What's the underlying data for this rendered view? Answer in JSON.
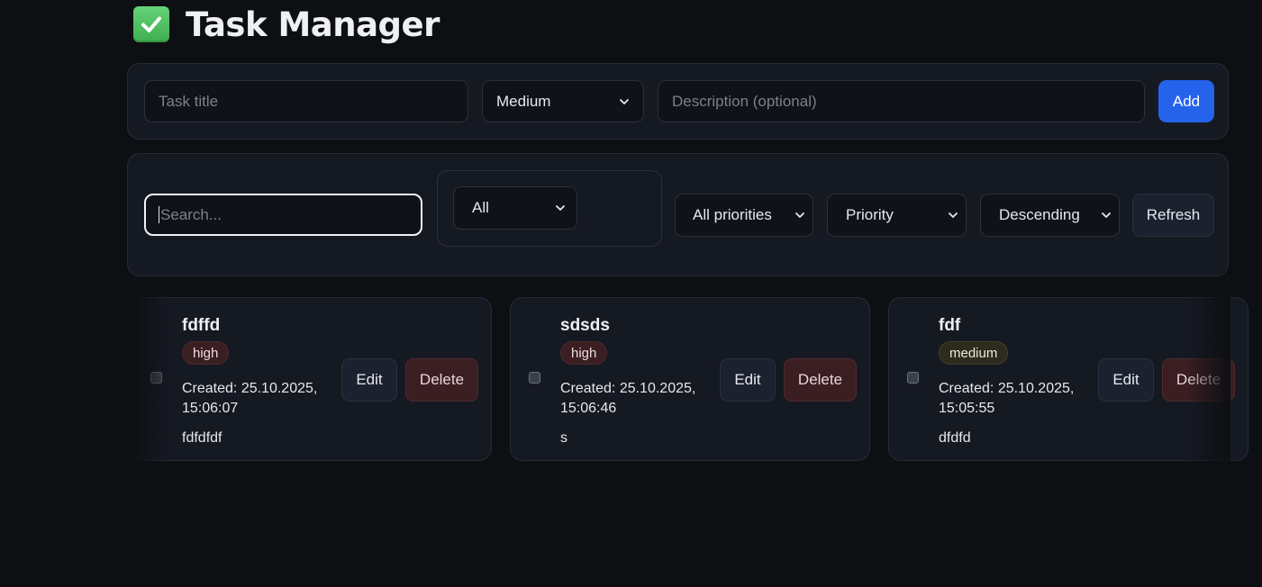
{
  "header": {
    "icon": "check-mark-button-icon",
    "title": "Task Manager"
  },
  "add_form": {
    "title_placeholder": "Task title",
    "priority_value": "Medium",
    "description_placeholder": "Description (optional)",
    "add_label": "Add"
  },
  "filters": {
    "search_placeholder": "Search...",
    "status_value": "All",
    "priority_filter_value": "All priorities",
    "sort_by_value": "Priority",
    "sort_order_value": "Descending",
    "refresh_label": "Refresh"
  },
  "tasks": [
    {
      "title": "fdffd",
      "priority": "high",
      "created_line1": "Created: 25.10.2025,",
      "created_line2": "15:06:07",
      "description": "fdfdfdf",
      "edit_label": "Edit",
      "delete_label": "Delete",
      "completed": false
    },
    {
      "title": "sdsds",
      "priority": "high",
      "created_line1": "Created: 25.10.2025,",
      "created_line2": "15:06:46",
      "description": "s",
      "edit_label": "Edit",
      "delete_label": "Delete",
      "completed": false
    },
    {
      "title": "fdf",
      "priority": "medium",
      "created_line1": "Created: 25.10.2025,",
      "created_line2": "15:05:55",
      "description": "dfdfd",
      "edit_label": "Edit",
      "delete_label": "Delete",
      "completed": false
    }
  ],
  "colors": {
    "background": "#0d0f13",
    "panel": "#151922",
    "accent": "#2563eb",
    "danger_bg": "#3a1e22",
    "medium_badge_bg": "#2c2b1e"
  }
}
